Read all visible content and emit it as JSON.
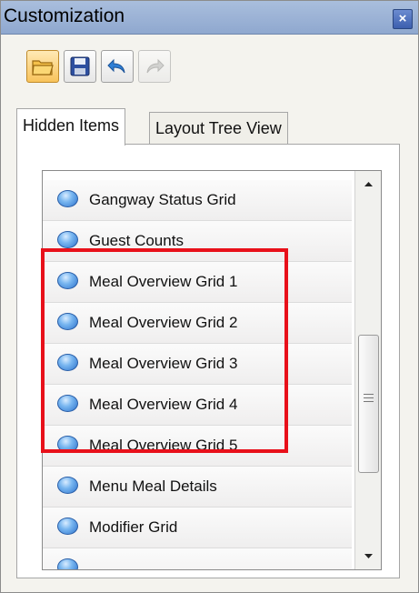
{
  "window": {
    "title": "Customization",
    "close_glyph": "×"
  },
  "toolbar": {
    "buttons": [
      {
        "name": "open-folder-icon",
        "state": "selected"
      },
      {
        "name": "save-icon",
        "state": "normal"
      },
      {
        "name": "undo-icon",
        "state": "normal"
      },
      {
        "name": "redo-icon",
        "state": "disabled"
      }
    ]
  },
  "tabs": [
    {
      "label": "Hidden Items",
      "active": true
    },
    {
      "label": "Layout Tree View",
      "active": false
    }
  ],
  "hidden_items": [
    "Gangway Status Grid",
    "Guest Counts",
    "Meal Overview Grid 1",
    "Meal Overview Grid 2",
    "Meal Overview Grid 3",
    "Meal Overview Grid 4",
    "Meal Overview Grid 5",
    "Menu Meal Details",
    "Modifier Grid"
  ],
  "highlighted_items": [
    "Meal Overview Grid 1",
    "Meal Overview Grid 2",
    "Meal Overview Grid 3",
    "Meal Overview Grid 4",
    "Meal Overview Grid 5"
  ],
  "colors": {
    "highlight": "#e8101a",
    "title_bar": "#a9bedd",
    "bullet": "#4a90e2"
  }
}
